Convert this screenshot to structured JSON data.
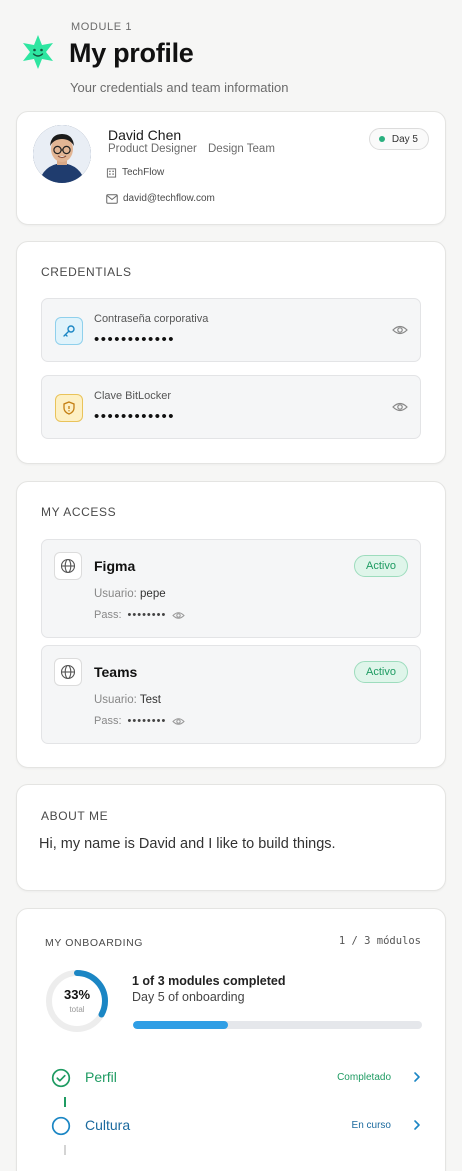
{
  "header": {
    "module_label": "MODULE 1",
    "title": "My profile",
    "subtitle": "Your credentials and team information"
  },
  "profile": {
    "name": "David Chen",
    "role": "Product Designer",
    "team": "Design Team",
    "company": "TechFlow",
    "email": "david@techflow.com",
    "day_badge": "Day 5"
  },
  "credentials": {
    "title": "CREDENTIALS",
    "items": [
      {
        "label": "Contraseña corporativa",
        "value": "••••••••••••",
        "icon": "key-icon"
      },
      {
        "label": "Clave BitLocker",
        "value": "••••••••••••",
        "icon": "shield-icon"
      }
    ]
  },
  "access": {
    "title": "MY ACCESS",
    "items": [
      {
        "name": "Figma",
        "status": "Activo",
        "user_label": "Usuario:",
        "user": "pepe",
        "pass_label": "Pass:",
        "pass": "••••••••"
      },
      {
        "name": "Teams",
        "status": "Activo",
        "user_label": "Usuario:",
        "user": "Test",
        "pass_label": "Pass:",
        "pass": "••••••••"
      }
    ]
  },
  "about": {
    "title": "ABOUT ME",
    "text": "Hi, my name is David and I like to build things."
  },
  "onboarding": {
    "title": "MY ONBOARDING",
    "count": "1 / 3 módulos",
    "percent_label": "33%",
    "percent_sub": "total",
    "progress": 0.33,
    "summary": "1 of 3 modules completed",
    "day_text": "Day 5 of onboarding",
    "steps": [
      {
        "label": "Perfil",
        "status": "Completado"
      },
      {
        "label": "Cultura",
        "status": "En curso"
      }
    ]
  },
  "colors": {
    "accent_green": "#1e9b62",
    "accent_blue": "#1b86c4",
    "progress_blue": "#2f9ee5",
    "logo_green": "#2ee6a1"
  }
}
